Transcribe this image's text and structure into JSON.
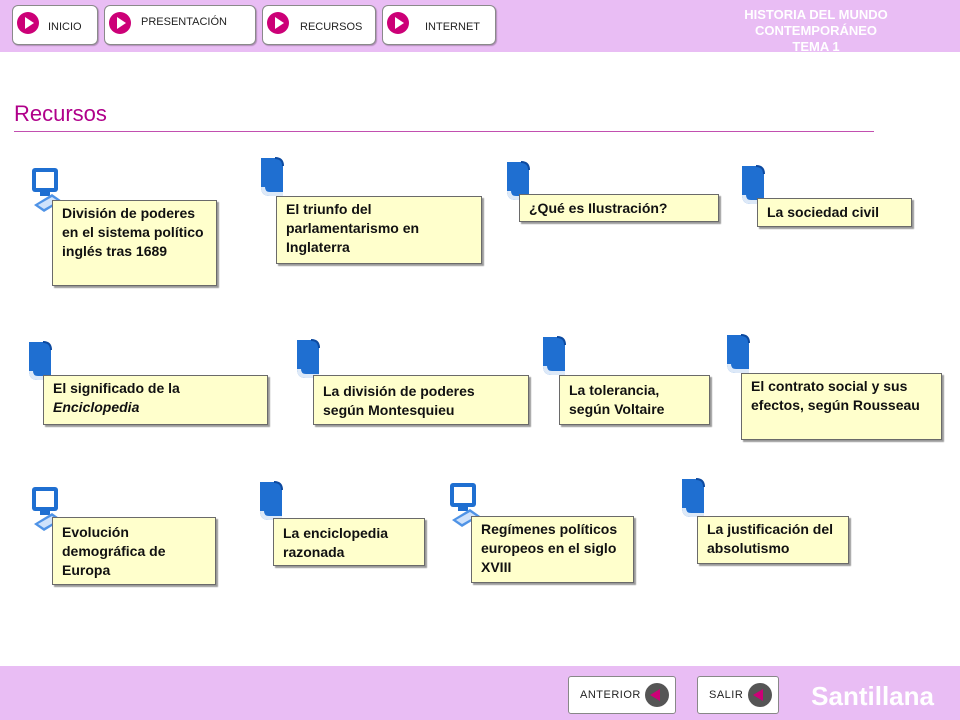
{
  "header": {
    "nav": [
      {
        "label": "INICIO"
      },
      {
        "label": "PRESENTACIÓN"
      },
      {
        "label": "RECURSOS"
      },
      {
        "label": "INTERNET"
      }
    ],
    "title_line1": "HISTORIA DEL MUNDO CONTEMPORÁNEO",
    "title_line2": "TEMA 1"
  },
  "page": {
    "title": "Recursos"
  },
  "resources": [
    {
      "text": "División de poderes en el sistema político inglés tras 1689",
      "icon": "monitor-icon"
    },
    {
      "text": "El triunfo del parlamentarismo en Inglaterra",
      "icon": "book-icon"
    },
    {
      "text": "¿Qué es Ilustración?",
      "icon": "book-icon"
    },
    {
      "text": "La sociedad civil",
      "icon": "book-icon"
    },
    {
      "text_prefix": "El significado de la",
      "text_italic": "Enciclopedia",
      "icon": "book-icon"
    },
    {
      "text": "La división de poderes según Montesquieu",
      "icon": "book-icon"
    },
    {
      "text": "La tolerancia, según Voltaire",
      "icon": "book-icon"
    },
    {
      "text": "El contrato social y sus efectos, según Rousseau",
      "icon": "book-icon"
    },
    {
      "text": "Evolución demográfica de Europa",
      "icon": "monitor-icon"
    },
    {
      "text": "La enciclopedia razonada",
      "icon": "book-icon"
    },
    {
      "text": "Regímenes políticos europeos en el siglo XVIII",
      "icon": "monitor-icon"
    },
    {
      "text": "La justificación del absolutismo",
      "icon": "book-icon"
    }
  ],
  "footer": {
    "prev_label": "ANTERIOR",
    "exit_label": "SALIR",
    "brand": "Santillana"
  },
  "colors": {
    "bar": "#e9bdf4",
    "accent": "#cc0077",
    "title": "#b0008a",
    "card": "#ffffcc",
    "icon": "#1f6fd1"
  }
}
